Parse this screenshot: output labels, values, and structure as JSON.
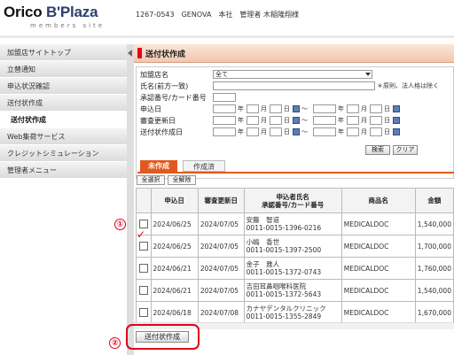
{
  "header": {
    "logo_main_o": "Orico",
    "logo_main_bp": "B'Plaza",
    "logo_sub": "members site",
    "info": "1267-0543　GENOVA　本社　管理者 木稲隆翔様"
  },
  "sidebar": {
    "items": [
      {
        "label": "加盟店サイトトップ"
      },
      {
        "label": "立替通知"
      },
      {
        "label": "申込状況確認"
      },
      {
        "label": "送付状作成"
      },
      {
        "label": "送付状作成"
      },
      {
        "label": "Web集荷サービス"
      },
      {
        "label": "クレジットシミュレーション"
      },
      {
        "label": "管理者メニュー"
      }
    ]
  },
  "main": {
    "title": "送付状作成",
    "form": {
      "store_label": "加盟店名",
      "store_value": "全て",
      "name_label": "氏名(前方一致)",
      "name_note": "＊原則、法人格は除く",
      "approval_label": "承認番号/カード番号",
      "apply_date_label": "申込日",
      "review_date_label": "審査更新日",
      "create_date_label": "送付状作成日",
      "year": "年",
      "month": "月",
      "day": "日",
      "tilde": "～",
      "search_button": "検索",
      "clear_button": "クリア"
    },
    "tabs": {
      "active": "未作成",
      "inactive": "作成済"
    },
    "select_all": "全選択",
    "deselect_all": "全解除",
    "table": {
      "headers": {
        "apply_date": "申込日",
        "review_date": "審査更新日",
        "applicant": "申込者氏名",
        "approval": "承認番号/カード番号",
        "product": "商品名",
        "amount": "金額"
      },
      "rows": [
        {
          "apply": "2024/06/25",
          "review": "2024/07/05",
          "name": "安藤　智道",
          "number": "0011-0015-1396-0216",
          "product": "MEDICALDOC",
          "amount": "1,540,000"
        },
        {
          "apply": "2024/06/25",
          "review": "2024/07/05",
          "name": "小嶋　香世",
          "number": "0011-0015-1397-2500",
          "product": "MEDICALDOC",
          "amount": "1,700,000"
        },
        {
          "apply": "2024/06/21",
          "review": "2024/07/05",
          "name": "金子　雅人",
          "number": "0011-0015-1372-0743",
          "product": "MEDICALDOC",
          "amount": "1,760,000"
        },
        {
          "apply": "2024/06/21",
          "review": "2024/07/05",
          "name": "吉田耳鼻咽喉科医院",
          "number": "0011-0015-1372-5643",
          "product": "MEDICALDOC",
          "amount": "1,540,000"
        },
        {
          "apply": "2024/06/18",
          "review": "2024/07/08",
          "name": "カナヤデンタルクリニック",
          "number": "0011-0015-1355-2849",
          "product": "MEDICALDOC",
          "amount": "1,670,000"
        }
      ]
    },
    "submit_button": "送付状作成",
    "markers": {
      "one": "①",
      "two": "②"
    }
  }
}
